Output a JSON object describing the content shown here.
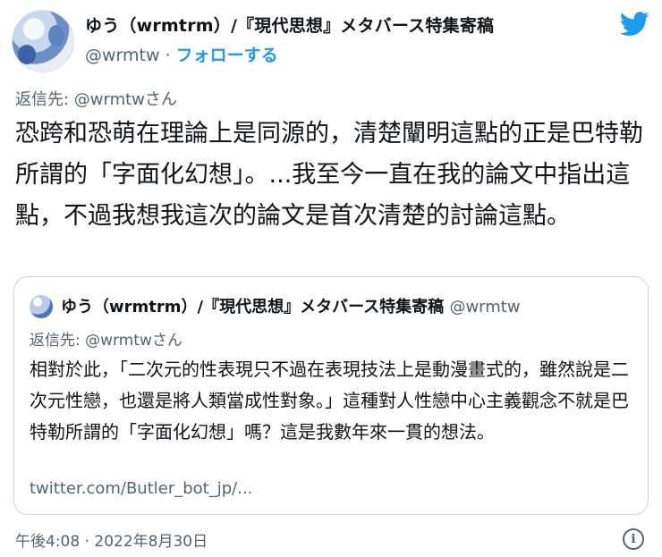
{
  "author": {
    "display_name": "ゆう（wrmtrm）/『現代思想』メタバース特集寄稿",
    "handle": "@wrmtw",
    "separator": " · ",
    "follow_label": "フォローする"
  },
  "icons": {
    "brand": "twitter-bird-icon",
    "info": "info-icon"
  },
  "colors": {
    "accent": "#1d9bf0",
    "secondary_text": "#536471",
    "border": "#cfd9de"
  },
  "tweet": {
    "replying_to": "返信先: @wrmtwさん",
    "text": "恐跨和恐萌在理論上是同源的，清楚闡明這點的正是巴特勒所謂的「字面化幻想」。...我至今一直在我的論文中指出這點，不過我想我這次的論文是首次清楚的討論這點。"
  },
  "quote": {
    "display_name": "ゆう（wrmtrm）/『現代思想』メタバース特集寄稿",
    "handle": "@wrmtw",
    "replying_to": "返信先: @wrmtwさん",
    "text": "相對於此，「二次元的性表現只不過在表現技法上是動漫畫式的，雖然說是二次元性戀，也還是將人類當成性對象。」這種對人性戀中心主義觀念不就是巴特勒所謂的「字面化幻想」嗎？這是我數年來一貫的想法。",
    "link": "twitter.com/Butler_bot_jp/..."
  },
  "timestamp": "午後4:08 · 2022年8月30日"
}
